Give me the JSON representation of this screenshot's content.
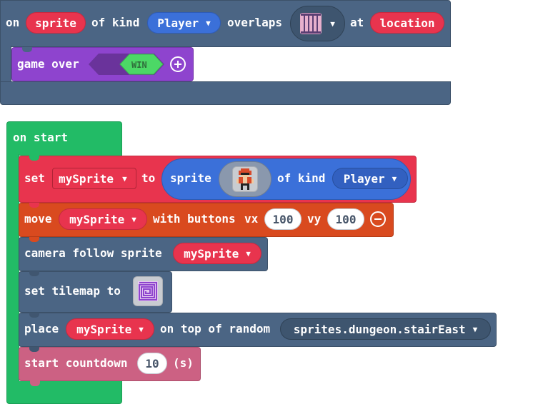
{
  "overlap_block": {
    "on": "on",
    "sprite_var": "sprite",
    "of_kind": "of kind",
    "kind": "Player",
    "overlaps": "overlaps",
    "tile_icon": "tile-icon",
    "at": "at",
    "location_var": "location"
  },
  "game_over_block": {
    "label": "game over",
    "result": "WIN"
  },
  "on_start_block": {
    "label": "on start"
  },
  "set_block": {
    "set": "set",
    "variable": "mySprite",
    "to": "to",
    "sprite": "sprite",
    "sprite_icon": "player-sprite-icon",
    "of_kind": "of kind",
    "kind": "Player"
  },
  "move_block": {
    "move": "move",
    "variable": "mySprite",
    "with_buttons": "with buttons",
    "vx_label": "vx",
    "vx": "100",
    "vy_label": "vy",
    "vy": "100"
  },
  "camera_block": {
    "label": "camera follow sprite",
    "variable": "mySprite"
  },
  "tilemap_block": {
    "label": "set tilemap to",
    "tilemap_icon": "tilemap-icon"
  },
  "place_block": {
    "place": "place",
    "variable": "mySprite",
    "on_top": "on top of random",
    "tile": "sprites.dungeon.stairEast"
  },
  "countdown_block": {
    "label": "start countdown",
    "value": "10",
    "unit": "(s)"
  },
  "colors": {
    "event_slate": "#4b6584",
    "game_purple": "#8e44ce",
    "loops_green": "#22bb66",
    "sprites_red": "#e8344e",
    "controller_orange": "#d94a1f",
    "info_pink": "#cc6183",
    "kind_blue": "#3b70d9"
  }
}
